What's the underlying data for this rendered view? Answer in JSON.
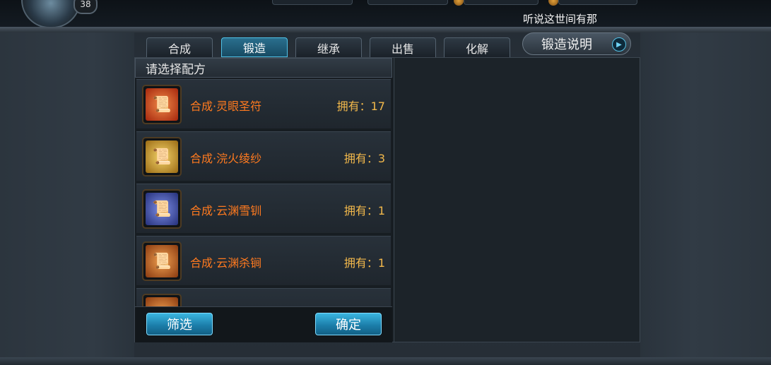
{
  "player": {
    "level": "38"
  },
  "marquee": "听说这世间有那",
  "tabs": [
    {
      "label": "合成",
      "active": false
    },
    {
      "label": "锻造",
      "active": true
    },
    {
      "label": "继承",
      "active": false
    },
    {
      "label": "出售",
      "active": false
    },
    {
      "label": "化解",
      "active": false
    }
  ],
  "help_button": {
    "label": "锻造说明",
    "icon": "play-arrow-icon"
  },
  "recipe_list": {
    "header": "请选择配方",
    "items": [
      {
        "name": "合成·灵眼圣符",
        "owned": "拥有：17",
        "icon": "red-scroll-icon",
        "icon_color": "#d4471c"
      },
      {
        "name": "合成·浣火绫纱",
        "owned": "拥有：3",
        "icon": "gold-scroll-icon",
        "icon_color": "#d9a52a"
      },
      {
        "name": "合成·云渊雪钏",
        "owned": "拥有：1",
        "icon": "blue-scroll-icon",
        "icon_color": "#3d4fb0"
      },
      {
        "name": "合成·云渊杀锏",
        "owned": "拥有：1",
        "icon": "orange-scroll-icon",
        "icon_color": "#c8641f"
      },
      {
        "name": "",
        "owned": "",
        "icon": "orange-scroll-icon",
        "icon_color": "#c8641f"
      }
    ]
  },
  "footer": {
    "filter_label": "筛选",
    "confirm_label": "确定"
  },
  "colors": {
    "accent": "#4fc2e8",
    "item_name": "#ff7a1f",
    "owned_text": "#f2b84b"
  }
}
